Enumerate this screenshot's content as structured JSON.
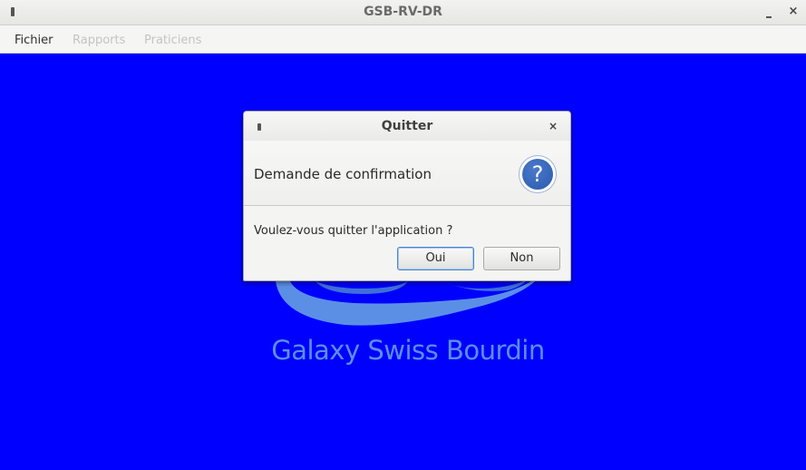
{
  "window": {
    "title": "GSB-RV-DR",
    "close_glyph": "×"
  },
  "menubar": {
    "items": [
      "Fichier",
      "Rapports",
      "Praticiens"
    ]
  },
  "background": {
    "color": "#0000ff",
    "logo_text": "Galaxy Swiss Bourdin"
  },
  "dialog": {
    "title": "Quitter",
    "close_glyph": "×",
    "header": "Demande de confirmation",
    "help_glyph": "?",
    "message": "Voulez-vous quitter l'application ?",
    "buttons": {
      "ok": "Oui",
      "cancel": "Non"
    }
  }
}
